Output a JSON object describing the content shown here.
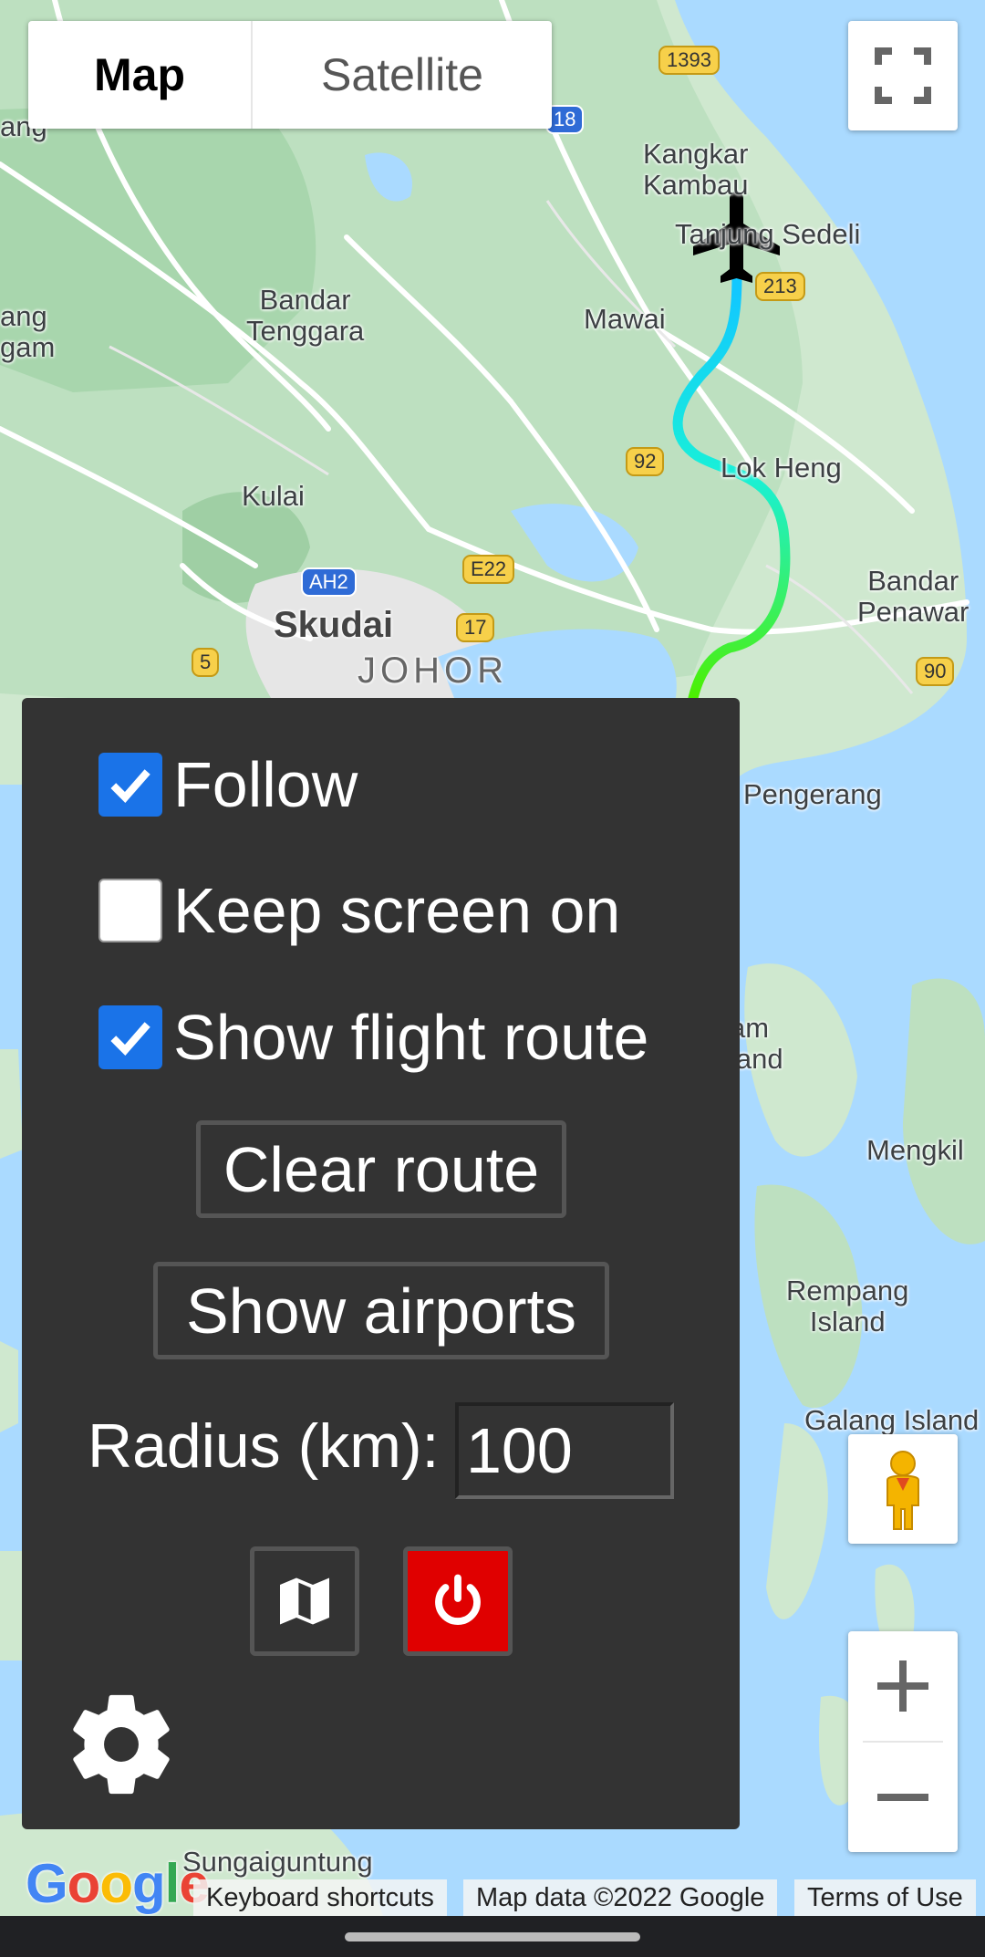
{
  "map_type": {
    "map_label": "Map",
    "satellite_label": "Satellite"
  },
  "map_labels": {
    "kangkar_kambau": "Kangkar\nKambau",
    "tanjung_sedeli": "Tanjung Sedeli",
    "bandar_tenggara": "Bandar\nTenggara",
    "mawai": "Mawai",
    "kulai": "Kulai",
    "lok_heng": "Lok Heng",
    "bandar_penawar": "Bandar\nPenawar",
    "skudai": "Skudai",
    "johor": "JOHOR",
    "pengerang": "Pengerang",
    "mengkil": "Mengkil",
    "rempang": "Rempang\nIsland",
    "galang": "Galang Island",
    "sungaiguntung": "Sungaiguntung",
    "sam_island": "am\nland",
    "left_ang": "ang",
    "left_ang2": "ang\ngam"
  },
  "shields": {
    "r1393": "1393",
    "r18": "18",
    "r213": "213",
    "r92": "92",
    "ah2": "AH2",
    "e22": "E22",
    "r17": "17",
    "r5": "5",
    "r90": "90"
  },
  "panel": {
    "follow": {
      "label": "Follow",
      "checked": true
    },
    "keep_screen": {
      "label": "Keep screen on",
      "checked": false
    },
    "show_route": {
      "label": "Show flight route",
      "checked": true
    },
    "clear_route_label": "Clear route",
    "show_airports_label": "Show airports",
    "radius_label": "Radius (km):",
    "radius_value": "100",
    "power_color": "#e00000"
  },
  "icons": {
    "fullscreen": "fullscreen-icon",
    "pegman": "pegman-icon",
    "zoom_in": "plus-icon",
    "zoom_out": "minus-icon",
    "map": "map-icon",
    "power": "power-icon",
    "settings": "gear-icon",
    "plane": "airplane-icon"
  },
  "footer": {
    "google": "Google",
    "keyboard": "Keyboard shortcuts",
    "map_data": "Map data ©2022 Google",
    "terms": "Terms of Use"
  }
}
